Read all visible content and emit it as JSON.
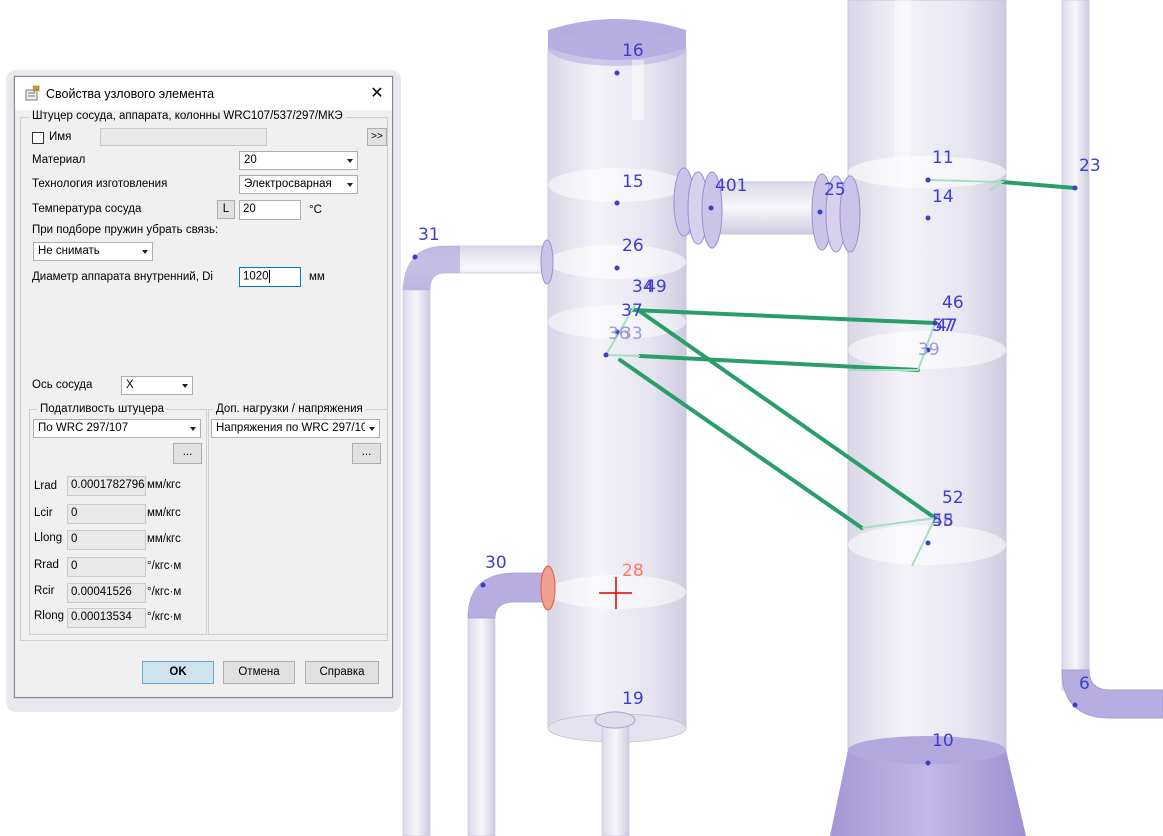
{
  "scene": {
    "node_labels": [
      "16",
      "15",
      "26",
      "31",
      "34",
      "49",
      "37",
      "36",
      "33",
      "11",
      "14",
      "401",
      "25",
      "23",
      "46",
      "57",
      "47",
      "39",
      "52",
      "55",
      "48",
      "30",
      "28",
      "19",
      "6",
      "10"
    ],
    "active_node": "28",
    "colors": {
      "pipe_fill": "#e8e6f1",
      "pipe_cap": "#b7aee0",
      "support_line": "#2a9e6a",
      "node_label": "#3c3ccf",
      "active_node_label": "#ff7a5c",
      "cursor": "#e00000"
    }
  },
  "dialog": {
    "title": "Свойства узлового элемента",
    "subtitle": "Штуцер сосуда, аппарата, колонны WRC107/537/297/МКЭ",
    "name_label": "Имя",
    "name_value": "",
    "expand_button": ">>",
    "material_label": "Материал",
    "material_value": "20",
    "technology_label": "Технология изготовления",
    "technology_value": "Электросварная",
    "temperature_label": "Температура сосуда",
    "temperature_l_button": "L",
    "temperature_value": "20",
    "temperature_unit": "°C",
    "springs_label": "При подборе пружин убрать связь:",
    "springs_value": "Не снимать",
    "diameter_label": "Диаметр аппарата внутренний, Di",
    "diameter_value": "1020",
    "diameter_unit": "мм",
    "axis_label": "Ось сосуда",
    "axis_value": "X",
    "flex_group_title": "Податливость штуцера",
    "flex_value": "По WRC 297/107",
    "flex_dots": "...",
    "loads_group_title": "Доп. нагрузки / напряжения",
    "loads_value": "Напряжения по WRC 297/107",
    "loads_dots": "...",
    "params": [
      {
        "name": "Lrad",
        "value": "0.00017827964",
        "unit": "мм/кгс"
      },
      {
        "name": "Lcir",
        "value": "0",
        "unit": "мм/кгс"
      },
      {
        "name": "Llong",
        "value": "0",
        "unit": "мм/кгс"
      },
      {
        "name": "Rrad",
        "value": "0",
        "unit": "°/кгс·м"
      },
      {
        "name": "Rcir",
        "value": "0.00041526",
        "unit": "°/кгс·м"
      },
      {
        "name": "Rlong",
        "value": "0.00013534",
        "unit": "°/кгс·м"
      }
    ],
    "ok_label": "OK",
    "cancel_label": "Отмена",
    "help_label": "Справка"
  }
}
